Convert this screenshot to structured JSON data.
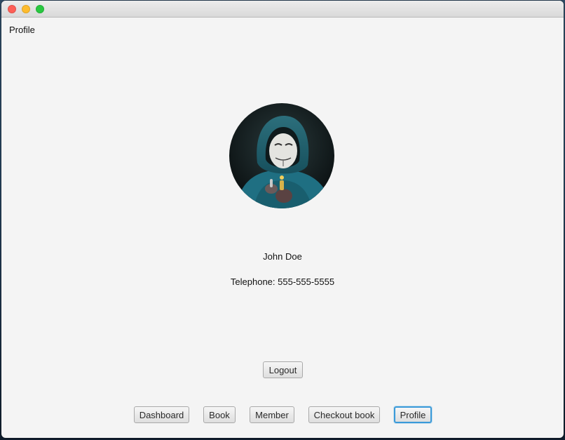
{
  "window": {
    "controls": [
      "close-icon",
      "minimize-icon",
      "maximize-icon"
    ]
  },
  "page": {
    "heading": "Profile"
  },
  "user": {
    "avatar": "avatar-photo",
    "name": "John Doe",
    "telephone": "Telephone: 555-555-5555"
  },
  "actions": {
    "logout_label": "Logout"
  },
  "nav": {
    "active": "Profile",
    "items": [
      "Dashboard",
      "Book",
      "Member",
      "Checkout book",
      "Profile"
    ]
  },
  "colors": {
    "window_bg": "#f4f4f4",
    "active_focus": "#3a9ad9"
  }
}
